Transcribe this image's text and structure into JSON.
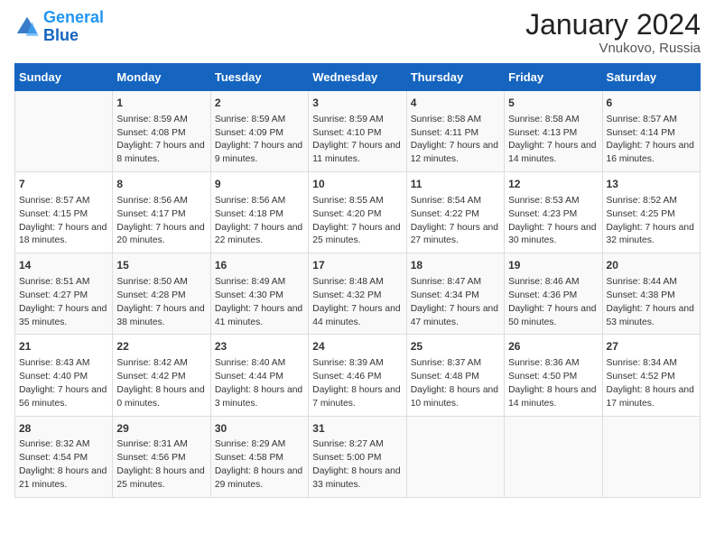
{
  "header": {
    "logo": {
      "line1": "General",
      "line2": "Blue"
    },
    "title": "January 2024",
    "location": "Vnukovo, Russia"
  },
  "days_of_week": [
    "Sunday",
    "Monday",
    "Tuesday",
    "Wednesday",
    "Thursday",
    "Friday",
    "Saturday"
  ],
  "weeks": [
    [
      {
        "day": "",
        "sunrise": "",
        "sunset": "",
        "daylight": ""
      },
      {
        "day": "1",
        "sunrise": "Sunrise: 8:59 AM",
        "sunset": "Sunset: 4:08 PM",
        "daylight": "Daylight: 7 hours and 8 minutes."
      },
      {
        "day": "2",
        "sunrise": "Sunrise: 8:59 AM",
        "sunset": "Sunset: 4:09 PM",
        "daylight": "Daylight: 7 hours and 9 minutes."
      },
      {
        "day": "3",
        "sunrise": "Sunrise: 8:59 AM",
        "sunset": "Sunset: 4:10 PM",
        "daylight": "Daylight: 7 hours and 11 minutes."
      },
      {
        "day": "4",
        "sunrise": "Sunrise: 8:58 AM",
        "sunset": "Sunset: 4:11 PM",
        "daylight": "Daylight: 7 hours and 12 minutes."
      },
      {
        "day": "5",
        "sunrise": "Sunrise: 8:58 AM",
        "sunset": "Sunset: 4:13 PM",
        "daylight": "Daylight: 7 hours and 14 minutes."
      },
      {
        "day": "6",
        "sunrise": "Sunrise: 8:57 AM",
        "sunset": "Sunset: 4:14 PM",
        "daylight": "Daylight: 7 hours and 16 minutes."
      }
    ],
    [
      {
        "day": "7",
        "sunrise": "Sunrise: 8:57 AM",
        "sunset": "Sunset: 4:15 PM",
        "daylight": "Daylight: 7 hours and 18 minutes."
      },
      {
        "day": "8",
        "sunrise": "Sunrise: 8:56 AM",
        "sunset": "Sunset: 4:17 PM",
        "daylight": "Daylight: 7 hours and 20 minutes."
      },
      {
        "day": "9",
        "sunrise": "Sunrise: 8:56 AM",
        "sunset": "Sunset: 4:18 PM",
        "daylight": "Daylight: 7 hours and 22 minutes."
      },
      {
        "day": "10",
        "sunrise": "Sunrise: 8:55 AM",
        "sunset": "Sunset: 4:20 PM",
        "daylight": "Daylight: 7 hours and 25 minutes."
      },
      {
        "day": "11",
        "sunrise": "Sunrise: 8:54 AM",
        "sunset": "Sunset: 4:22 PM",
        "daylight": "Daylight: 7 hours and 27 minutes."
      },
      {
        "day": "12",
        "sunrise": "Sunrise: 8:53 AM",
        "sunset": "Sunset: 4:23 PM",
        "daylight": "Daylight: 7 hours and 30 minutes."
      },
      {
        "day": "13",
        "sunrise": "Sunrise: 8:52 AM",
        "sunset": "Sunset: 4:25 PM",
        "daylight": "Daylight: 7 hours and 32 minutes."
      }
    ],
    [
      {
        "day": "14",
        "sunrise": "Sunrise: 8:51 AM",
        "sunset": "Sunset: 4:27 PM",
        "daylight": "Daylight: 7 hours and 35 minutes."
      },
      {
        "day": "15",
        "sunrise": "Sunrise: 8:50 AM",
        "sunset": "Sunset: 4:28 PM",
        "daylight": "Daylight: 7 hours and 38 minutes."
      },
      {
        "day": "16",
        "sunrise": "Sunrise: 8:49 AM",
        "sunset": "Sunset: 4:30 PM",
        "daylight": "Daylight: 7 hours and 41 minutes."
      },
      {
        "day": "17",
        "sunrise": "Sunrise: 8:48 AM",
        "sunset": "Sunset: 4:32 PM",
        "daylight": "Daylight: 7 hours and 44 minutes."
      },
      {
        "day": "18",
        "sunrise": "Sunrise: 8:47 AM",
        "sunset": "Sunset: 4:34 PM",
        "daylight": "Daylight: 7 hours and 47 minutes."
      },
      {
        "day": "19",
        "sunrise": "Sunrise: 8:46 AM",
        "sunset": "Sunset: 4:36 PM",
        "daylight": "Daylight: 7 hours and 50 minutes."
      },
      {
        "day": "20",
        "sunrise": "Sunrise: 8:44 AM",
        "sunset": "Sunset: 4:38 PM",
        "daylight": "Daylight: 7 hours and 53 minutes."
      }
    ],
    [
      {
        "day": "21",
        "sunrise": "Sunrise: 8:43 AM",
        "sunset": "Sunset: 4:40 PM",
        "daylight": "Daylight: 7 hours and 56 minutes."
      },
      {
        "day": "22",
        "sunrise": "Sunrise: 8:42 AM",
        "sunset": "Sunset: 4:42 PM",
        "daylight": "Daylight: 8 hours and 0 minutes."
      },
      {
        "day": "23",
        "sunrise": "Sunrise: 8:40 AM",
        "sunset": "Sunset: 4:44 PM",
        "daylight": "Daylight: 8 hours and 3 minutes."
      },
      {
        "day": "24",
        "sunrise": "Sunrise: 8:39 AM",
        "sunset": "Sunset: 4:46 PM",
        "daylight": "Daylight: 8 hours and 7 minutes."
      },
      {
        "day": "25",
        "sunrise": "Sunrise: 8:37 AM",
        "sunset": "Sunset: 4:48 PM",
        "daylight": "Daylight: 8 hours and 10 minutes."
      },
      {
        "day": "26",
        "sunrise": "Sunrise: 8:36 AM",
        "sunset": "Sunset: 4:50 PM",
        "daylight": "Daylight: 8 hours and 14 minutes."
      },
      {
        "day": "27",
        "sunrise": "Sunrise: 8:34 AM",
        "sunset": "Sunset: 4:52 PM",
        "daylight": "Daylight: 8 hours and 17 minutes."
      }
    ],
    [
      {
        "day": "28",
        "sunrise": "Sunrise: 8:32 AM",
        "sunset": "Sunset: 4:54 PM",
        "daylight": "Daylight: 8 hours and 21 minutes."
      },
      {
        "day": "29",
        "sunrise": "Sunrise: 8:31 AM",
        "sunset": "Sunset: 4:56 PM",
        "daylight": "Daylight: 8 hours and 25 minutes."
      },
      {
        "day": "30",
        "sunrise": "Sunrise: 8:29 AM",
        "sunset": "Sunset: 4:58 PM",
        "daylight": "Daylight: 8 hours and 29 minutes."
      },
      {
        "day": "31",
        "sunrise": "Sunrise: 8:27 AM",
        "sunset": "Sunset: 5:00 PM",
        "daylight": "Daylight: 8 hours and 33 minutes."
      },
      {
        "day": "",
        "sunrise": "",
        "sunset": "",
        "daylight": ""
      },
      {
        "day": "",
        "sunrise": "",
        "sunset": "",
        "daylight": ""
      },
      {
        "day": "",
        "sunrise": "",
        "sunset": "",
        "daylight": ""
      }
    ]
  ]
}
